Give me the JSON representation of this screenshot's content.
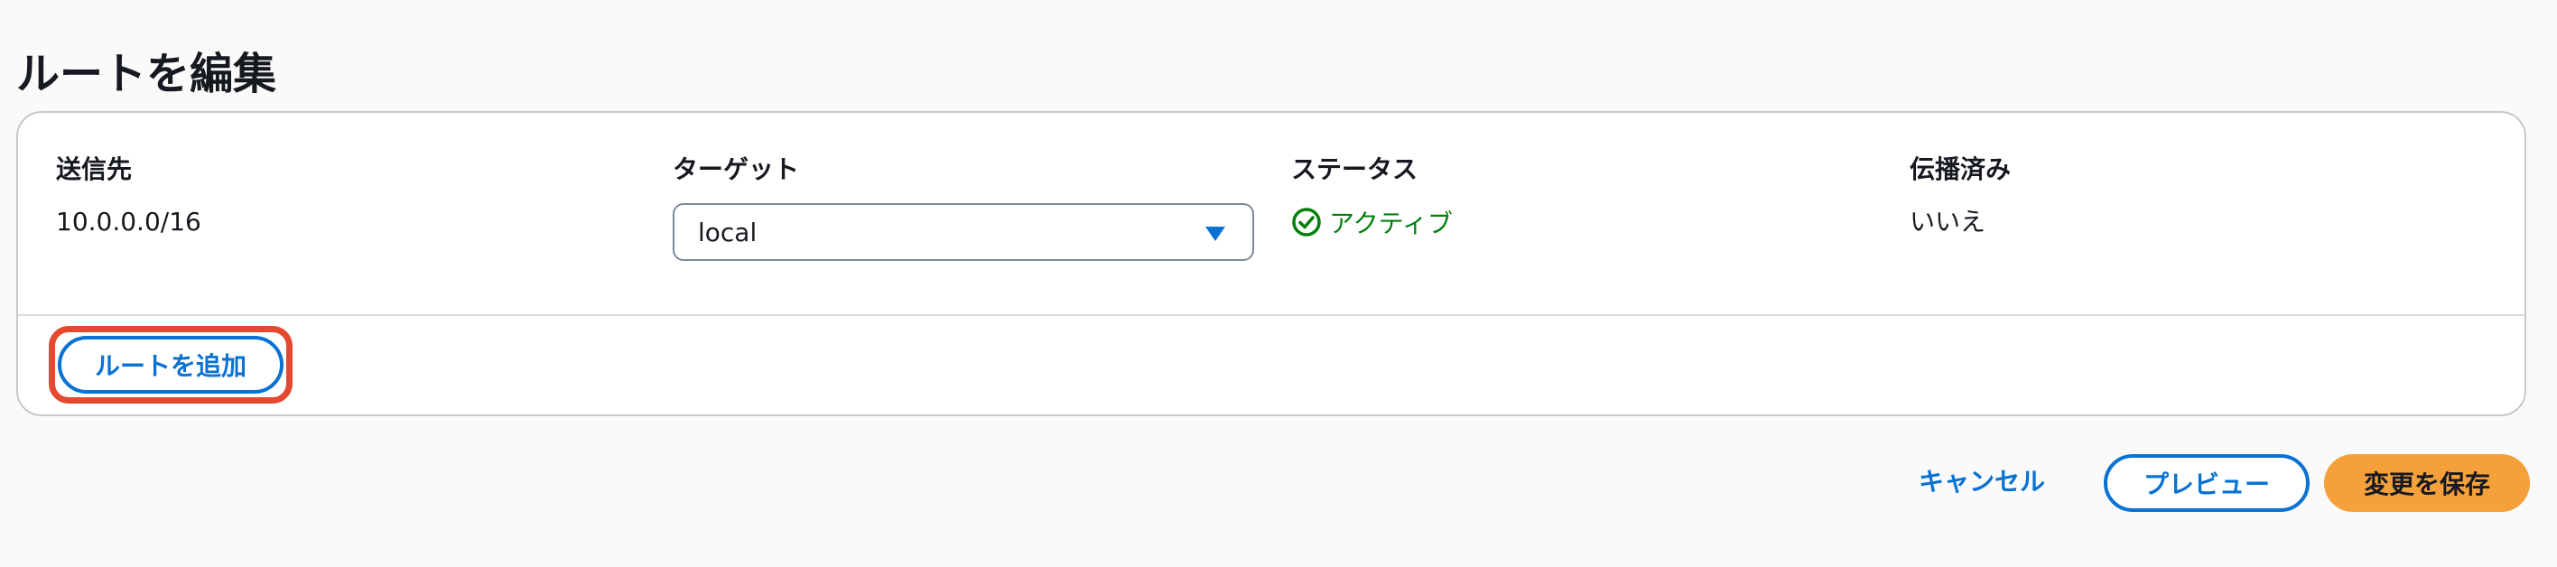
{
  "page": {
    "title": "ルートを編集"
  },
  "routes_table": {
    "columns": [
      "送信先",
      "ターゲット",
      "ステータス",
      "伝播済み"
    ],
    "rows": [
      {
        "destination": "10.0.0.0/16",
        "target": "local",
        "status": "アクティブ",
        "propagated": "いいえ"
      }
    ],
    "add_route_label": "ルートを追加"
  },
  "footer": {
    "cancel_label": "キャンセル",
    "preview_label": "プレビュー",
    "save_label": "変更を保存"
  },
  "icons": {
    "status": "check-circle-icon",
    "select": "caret-down-icon"
  },
  "colors": {
    "accent": "#0972d3",
    "success": "#037f0c",
    "primary_button": "#f5a03b",
    "highlight": "#e4482e"
  }
}
